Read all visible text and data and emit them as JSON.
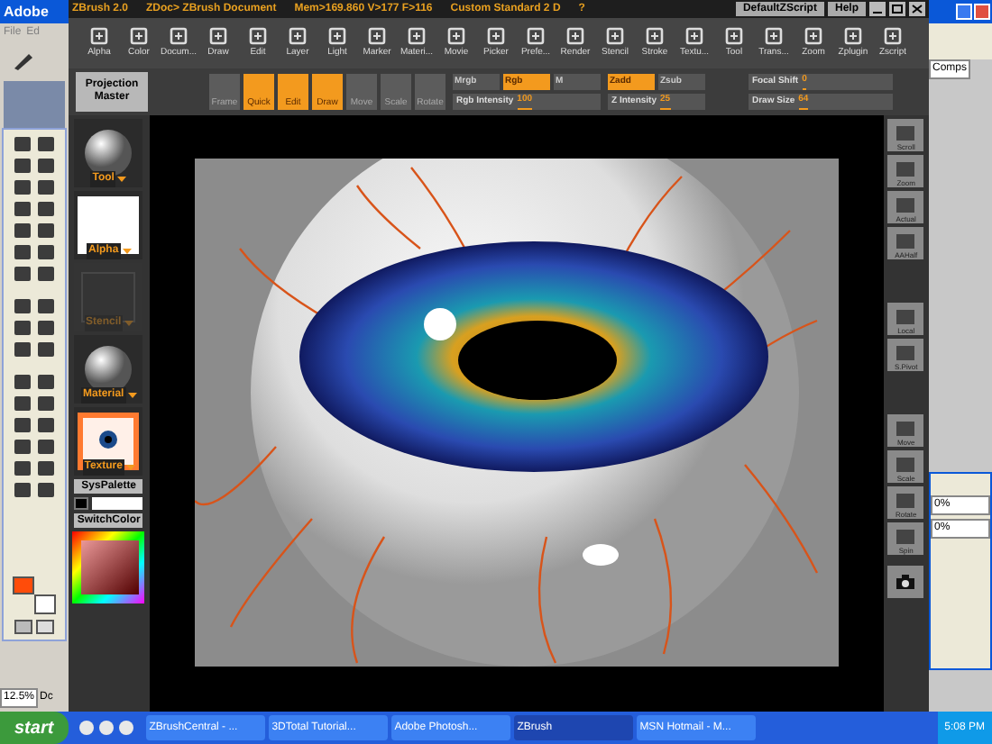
{
  "photoshop": {
    "title": "Adobe",
    "menu": [
      "File",
      "Ed"
    ],
    "zoom": "12.5%",
    "status": "Dc"
  },
  "zbrush": {
    "title": "ZBrush 2.0",
    "document": "ZDoc> ZBrush Document",
    "stats": "Mem>169.860 V>177 F>116",
    "layout": "Custom Standard 2 D",
    "help_mark": "?",
    "buttons": [
      "DefaultZScript",
      "Help"
    ]
  },
  "menus": [
    "Alpha",
    "Color",
    "Docum...",
    "Draw",
    "Edit",
    "Layer",
    "Light",
    "Marker",
    "Materi...",
    "Movie",
    "Picker",
    "Prefe...",
    "Render",
    "Stencil",
    "Stroke",
    "Textu...",
    "Tool",
    "Trans...",
    "Zoom",
    "Zplugin",
    "Zscript"
  ],
  "projection_master": "Projection Master",
  "edit_modes": [
    {
      "label": "Frame",
      "selected": false
    },
    {
      "label": "Quick",
      "selected": true
    },
    {
      "label": "Edit",
      "selected": true
    },
    {
      "label": "Draw",
      "selected": true
    },
    {
      "label": "Move",
      "selected": false
    },
    {
      "label": "Scale",
      "selected": false
    },
    {
      "label": "Rotate",
      "selected": false
    }
  ],
  "color_channels": [
    {
      "label": "Mrgb",
      "selected": false
    },
    {
      "label": "Rgb",
      "selected": true
    },
    {
      "label": "M",
      "selected": false
    }
  ],
  "depth_channels": [
    {
      "label": "Zadd",
      "selected": true
    },
    {
      "label": "Zsub",
      "selected": false
    }
  ],
  "rgb_intensity": {
    "label": "Rgb Intensity",
    "value": "100"
  },
  "z_intensity": {
    "label": "Z Intensity",
    "value": "25"
  },
  "focal_shift": {
    "label": "Focal Shift",
    "value": "0"
  },
  "draw_size": {
    "label": "Draw Size",
    "value": "64"
  },
  "left_shelf": [
    {
      "label": "Tool",
      "kind": "sphere",
      "disabled": false
    },
    {
      "label": "Alpha",
      "kind": "blank",
      "disabled": false
    },
    {
      "label": "Stencil",
      "kind": "empty",
      "disabled": true
    },
    {
      "label": "Material",
      "kind": "sphere",
      "disabled": false
    },
    {
      "label": "Texture",
      "kind": "texture",
      "disabled": false
    }
  ],
  "sys_palette": "SysPalette",
  "switch_color": "SwitchColor",
  "right_shelf": [
    {
      "buttons": [
        "Scroll",
        "Zoom",
        "Actual",
        "AAHalf"
      ]
    },
    {
      "buttons": [
        "Local",
        "S.Pivot"
      ]
    },
    {
      "buttons": [
        "Move",
        "Scale",
        "Rotate",
        "Spin"
      ]
    }
  ],
  "side_panel": {
    "tab": "Comps",
    "values": [
      "0%",
      "0%"
    ]
  },
  "taskbar": {
    "start": "start",
    "tasks": [
      {
        "label": "ZBrushCentral - ...",
        "selected": false
      },
      {
        "label": "3DTotal Tutorial...",
        "selected": false
      },
      {
        "label": "Adobe Photosh...",
        "selected": false
      },
      {
        "label": "ZBrush",
        "selected": true
      },
      {
        "label": "MSN Hotmail - M...",
        "selected": false
      }
    ],
    "clock": "5:08 PM"
  }
}
